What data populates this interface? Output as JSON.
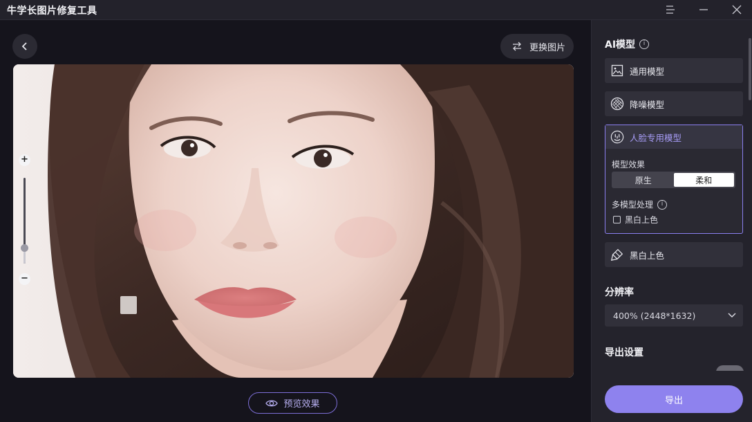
{
  "app": {
    "title": "牛学长图片修复工具"
  },
  "toolbar": {
    "replace_label": "更换图片",
    "preview_label": "预览效果"
  },
  "zoom": {
    "level": 0.18
  },
  "ai_model": {
    "title": "AI模型",
    "models": [
      {
        "label": "通用模型",
        "icon": "image-icon"
      },
      {
        "label": "降噪模型",
        "icon": "denoise-icon"
      },
      {
        "label": "人脸专用模型",
        "icon": "face-icon",
        "active": true
      },
      {
        "label": "黑白上色",
        "icon": "brush-icon"
      }
    ],
    "effect_label": "模型效果",
    "effect_options": [
      "原生",
      "柔和"
    ],
    "effect_selected": "柔和",
    "multi_label": "多模型处理",
    "colorize_checkbox_label": "黑白上色"
  },
  "resolution": {
    "title": "分辨率",
    "value": "400% (2448*1632)"
  },
  "export_settings": {
    "title": "导出设置",
    "button_label": "导出"
  },
  "colors": {
    "accent": "#8e82ee",
    "background": "#15141c",
    "panel": "#24232c"
  }
}
